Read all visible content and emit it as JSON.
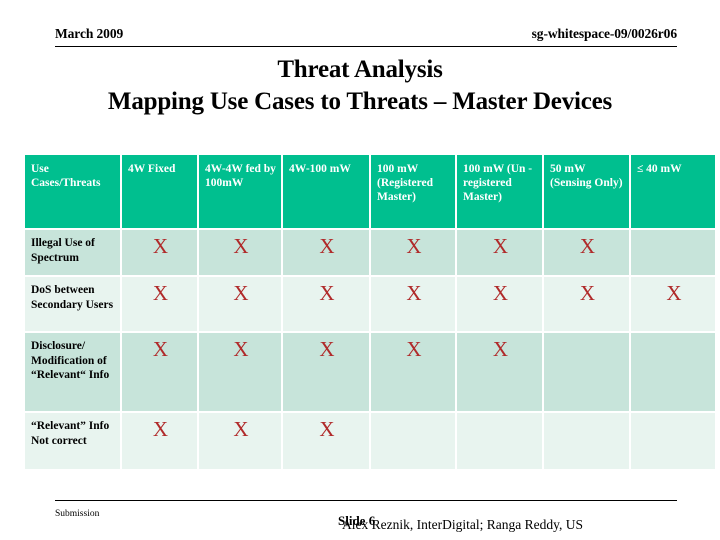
{
  "header": {
    "date": "March 2009",
    "doc_id": "sg-whitespace-09/0026r06"
  },
  "title": {
    "line1": "Threat Analysis",
    "line2": "Mapping Use Cases to Threats – Master Devices"
  },
  "table": {
    "columns": [
      "Use Cases/Threats",
      "4W Fixed",
      "4W-4W fed by 100mW",
      "4W-100 mW",
      "100 mW (Registered Master)",
      "100 mW (Un - registered Master)",
      "50 mW (Sensing Only)",
      "≤ 40 mW"
    ],
    "mark": "X",
    "rows": [
      {
        "label": "Illegal Use of Spectrum",
        "marks": [
          true,
          true,
          true,
          true,
          true,
          true,
          false
        ]
      },
      {
        "label": "DoS between Secondary Users",
        "marks": [
          true,
          true,
          true,
          true,
          true,
          true,
          true
        ]
      },
      {
        "label": "Disclosure/ Modification of “Relevant“ Info",
        "marks": [
          true,
          true,
          true,
          true,
          true,
          false,
          false
        ]
      },
      {
        "label": "“Relevant” Info Not correct",
        "marks": [
          true,
          true,
          true,
          false,
          false,
          false,
          false
        ]
      }
    ]
  },
  "footer": {
    "left": "Submission",
    "slide": "Slide 6",
    "authors": "Alex Reznik, InterDigital; Ranga Reddy, US"
  },
  "colors": {
    "header_bg": "#00bf8f",
    "header_text": "#ffffff",
    "row_dark": "#c7e4da",
    "row_light": "#e8f4ef",
    "mark_color": "#b02a2a"
  }
}
